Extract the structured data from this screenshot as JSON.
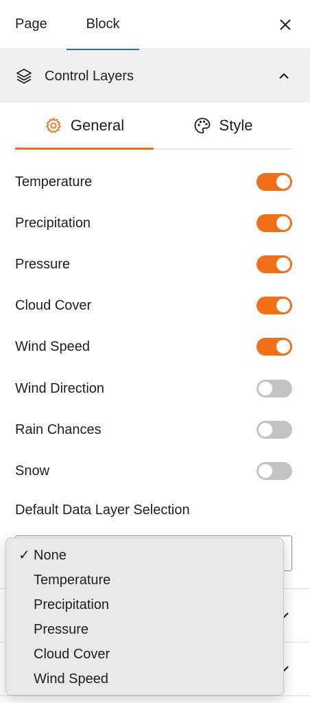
{
  "tabs": {
    "page": "Page",
    "block": "Block"
  },
  "panel": {
    "title": "Control Layers"
  },
  "subtabs": {
    "general": "General",
    "style": "Style"
  },
  "colors": {
    "accent": "#f26f1a",
    "active_tab": "#2271b1",
    "toggle_off": "#c2c2c2"
  },
  "toggles": [
    {
      "label": "Temperature",
      "on": true
    },
    {
      "label": "Precipitation",
      "on": true
    },
    {
      "label": "Pressure",
      "on": true
    },
    {
      "label": "Cloud Cover",
      "on": true
    },
    {
      "label": "Wind Speed",
      "on": true
    },
    {
      "label": "Wind Direction",
      "on": false
    },
    {
      "label": "Rain Chances",
      "on": false
    },
    {
      "label": "Snow",
      "on": false
    }
  ],
  "default_layer": {
    "label": "Default Data Layer Selection",
    "selected": "None",
    "options": [
      "None",
      "Temperature",
      "Precipitation",
      "Pressure",
      "Cloud Cover",
      "Wind Speed"
    ],
    "check_mark": "✓"
  },
  "icons": {
    "close": "close-icon",
    "layers": "layers-icon",
    "collapse": "chevron-up-icon",
    "general": "gear-icon",
    "style": "palette-icon",
    "expand": "chevron-down-icon"
  }
}
